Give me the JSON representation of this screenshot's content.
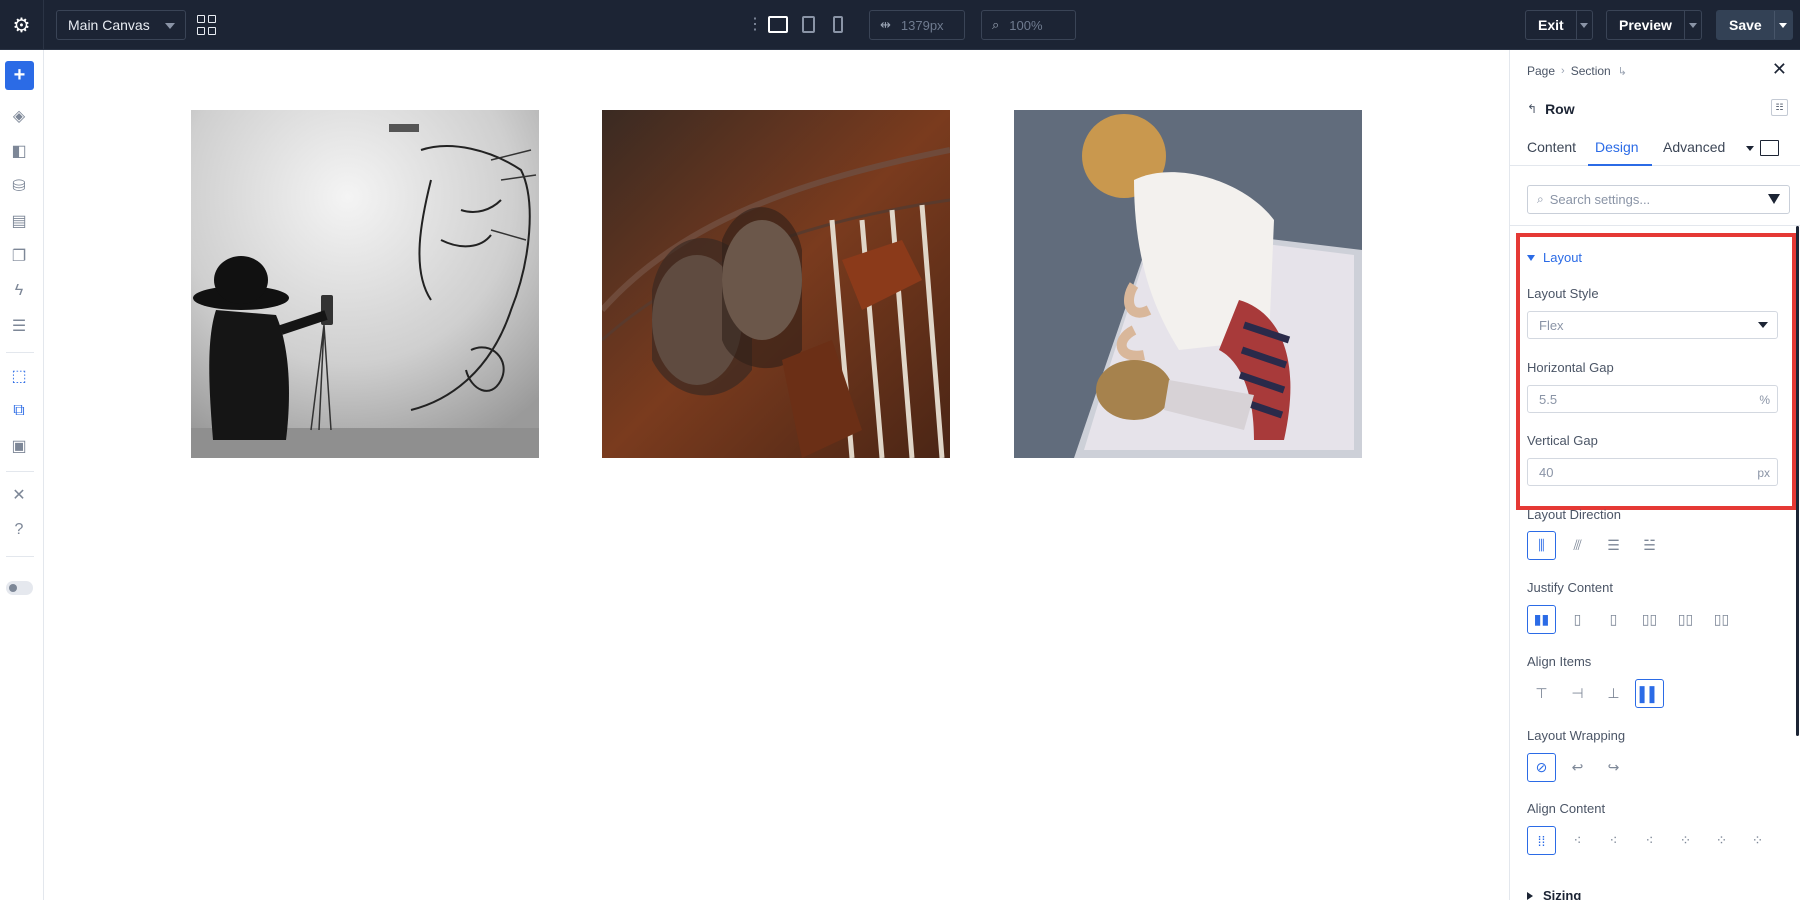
{
  "topbar": {
    "canvas_name": "Main Canvas",
    "width_value": "1379px",
    "zoom_value": "100%",
    "exit_label": "Exit",
    "preview_label": "Preview",
    "save_label": "Save",
    "icons": [
      "gear-icon",
      "grid-icon",
      "more-vertical-icon",
      "desktop-icon",
      "tablet-icon",
      "phone-icon",
      "width-icon",
      "zoom-icon"
    ]
  },
  "leftbar": {
    "icons": [
      "add-icon",
      "layers-icon",
      "presets-icon",
      "database-icon",
      "form-icon",
      "pages-icon",
      "lightning-icon",
      "layout-icon",
      "select-icon",
      "multi-select-icon",
      "preview-icon",
      "tools-icon",
      "help-icon",
      "theme-toggle-icon"
    ]
  },
  "canvas": {
    "images": [
      {
        "description_icon": "photo-gallery-wall-sketch"
      },
      {
        "description_icon": "photo-mural"
      },
      {
        "description_icon": "photo-child-mirror"
      }
    ]
  },
  "panel": {
    "breadcrumb": {
      "page": "Page",
      "section": "Section"
    },
    "title": "Row",
    "tabs": [
      {
        "label": "Content"
      },
      {
        "label": "Design"
      },
      {
        "label": "Advanced"
      }
    ],
    "search_placeholder": "Search settings...",
    "layout_section": "Layout",
    "layout_style_label": "Layout Style",
    "layout_style_value": "Flex",
    "horizontal_gap_label": "Horizontal Gap",
    "horizontal_gap_value": "5.5",
    "horizontal_gap_unit": "%",
    "vertical_gap_label": "Vertical Gap",
    "vertical_gap_value": "40",
    "vertical_gap_unit": "px",
    "layout_direction_label": "Layout Direction",
    "justify_content_label": "Justify Content",
    "align_items_label": "Align Items",
    "layout_wrapping_label": "Layout Wrapping",
    "align_content_label": "Align Content",
    "sizing_label": "Sizing",
    "colors": {
      "accent": "#2b6be6",
      "highlight": "#e53935",
      "topbar": "#1c2434"
    }
  }
}
